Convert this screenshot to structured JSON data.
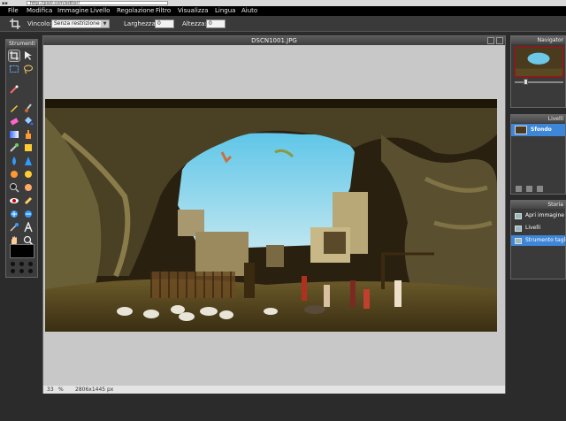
{
  "browser": {
    "url": "http://pixlr.com/editor/"
  },
  "menu": [
    "File",
    "Modifica",
    "Immagine",
    "Livello",
    "Regolazione",
    "Filtro",
    "Visualizza",
    "Lingua",
    "Aiuto"
  ],
  "tool_options": {
    "vincolo_label": "Vincolo:",
    "vincolo_value": "Senza restrizione",
    "larghezza_label": "Larghezza:",
    "larghezza_value": "0",
    "altezza_label": "Altezza:",
    "altezza_value": "0"
  },
  "toolbox": {
    "title": "Strumenti"
  },
  "canvas": {
    "title": "DSCN1001.JPG",
    "zoom": "33",
    "zoom_unit": "%",
    "dimensions": "2806x1445 px"
  },
  "panels": {
    "navigator": {
      "title": "Navigator"
    },
    "layers": {
      "title": "Livelli",
      "items": [
        {
          "name": "Sfondo"
        }
      ]
    },
    "history": {
      "title": "Storia",
      "items": [
        {
          "label": "Apri immagine"
        },
        {
          "label": "Livelli"
        },
        {
          "label": "Strumento taglio"
        }
      ]
    }
  },
  "colors": {
    "accent": "#3d86d8",
    "menubar": "#000000",
    "foreground": "#000000"
  },
  "icons": [
    "crop-icon",
    "move-icon",
    "marquee-icon",
    "lasso-icon",
    "wand-icon",
    "pencil-icon",
    "brush-icon",
    "eraser-icon",
    "bucket-icon",
    "gradient-icon",
    "clone-icon",
    "color-replace-icon",
    "drawing-icon",
    "blur-icon",
    "sharpen-icon",
    "smudge-icon",
    "sponge-icon",
    "dodge-icon",
    "burn-icon",
    "redeye-icon",
    "spot-heal-icon",
    "bloat-icon",
    "pinch-icon",
    "eyedropper-icon",
    "text-icon",
    "hand-icon",
    "zoom-icon"
  ]
}
